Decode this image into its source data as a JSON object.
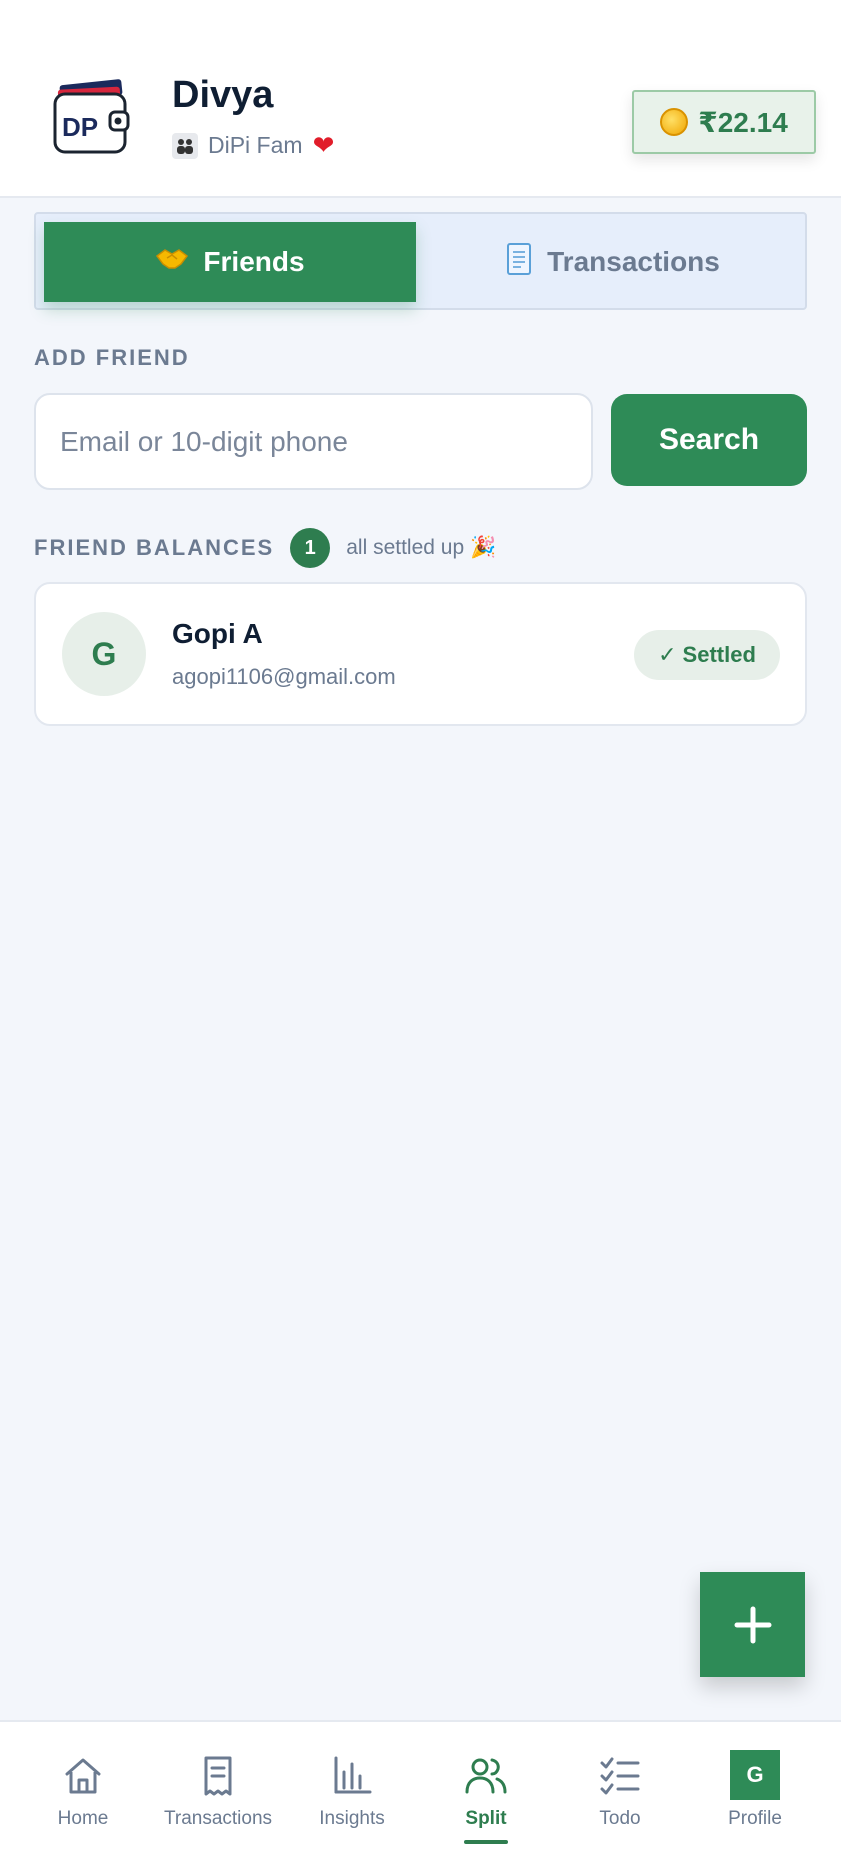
{
  "header": {
    "logo_text": "DP",
    "user_name": "Divya",
    "family_name": "DiPi Fam",
    "balance": "₹22.14"
  },
  "tabs": [
    {
      "label": "Friends",
      "active": true
    },
    {
      "label": "Transactions",
      "active": false
    }
  ],
  "add_friend": {
    "section_label": "ADD FRIEND",
    "input_placeholder": "Email or 10-digit phone",
    "input_value": "",
    "search_label": "Search"
  },
  "friend_balances": {
    "section_label": "FRIEND BALANCES",
    "count": "1",
    "summary": "all settled up 🎉",
    "friends": [
      {
        "initial": "G",
        "name": "Gopi A",
        "email": "agopi1106@gmail.com",
        "status": "Settled"
      }
    ]
  },
  "fab": {
    "icon": "plus-icon"
  },
  "bottom_nav": {
    "items": [
      {
        "label": "Home",
        "icon": "home-icon"
      },
      {
        "label": "Transactions",
        "icon": "receipt-icon"
      },
      {
        "label": "Insights",
        "icon": "bar-chart-icon"
      },
      {
        "label": "Split",
        "icon": "users-icon",
        "active": true
      },
      {
        "label": "Todo",
        "icon": "checklist-icon"
      },
      {
        "label": "Profile",
        "icon": "profile-avatar",
        "initial": "G"
      }
    ]
  },
  "colors": {
    "primary": "#2e8b57",
    "primary_dark": "#2e7d4f",
    "muted_text": "#6b7a90",
    "background": "#f3f6fb"
  }
}
